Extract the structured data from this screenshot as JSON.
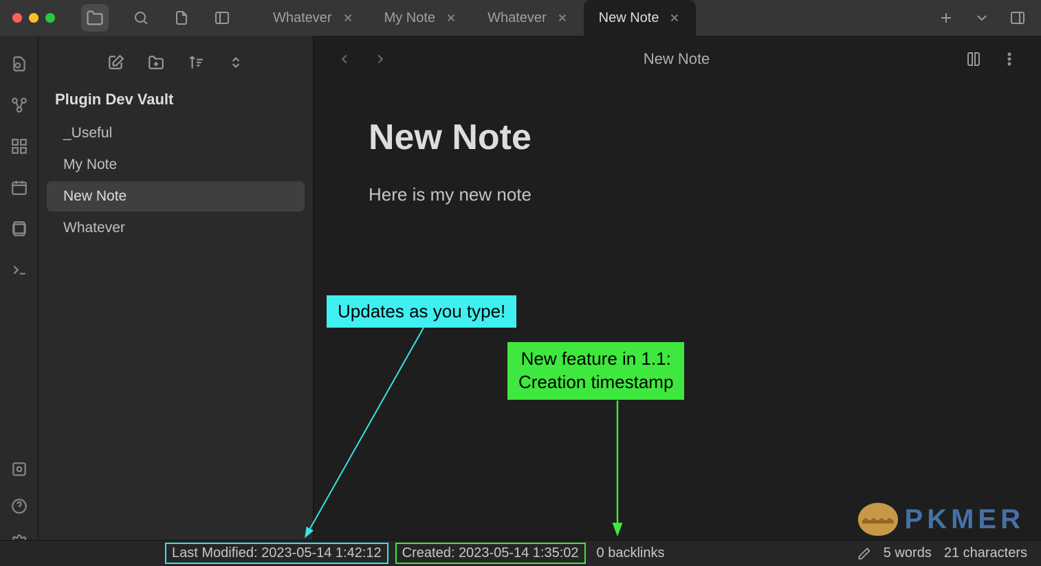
{
  "tabs": [
    {
      "label": "Whatever",
      "active": false
    },
    {
      "label": "My Note",
      "active": false
    },
    {
      "label": "Whatever",
      "active": false
    },
    {
      "label": "New Note",
      "active": true
    }
  ],
  "vault": {
    "name": "Plugin Dev Vault"
  },
  "files": [
    {
      "name": "_Useful",
      "selected": false
    },
    {
      "name": "My Note",
      "selected": false
    },
    {
      "name": "New Note",
      "selected": true
    },
    {
      "name": "Whatever",
      "selected": false
    }
  ],
  "editor": {
    "header_title": "New Note",
    "note_title": "New Note",
    "body": "Here is my new note"
  },
  "status": {
    "modified_label": "Last Modified: 2023-05-14 1:42:12",
    "created_label": "Created: 2023-05-14 1:35:02",
    "backlinks": "0 backlinks",
    "words": "5 words",
    "characters": "21 characters"
  },
  "annotations": {
    "updates": "Updates as you type!",
    "new_feature_line1": "New feature in 1.1:",
    "new_feature_line2": "Creation timestamp"
  },
  "watermark": {
    "text": "PKMER"
  }
}
